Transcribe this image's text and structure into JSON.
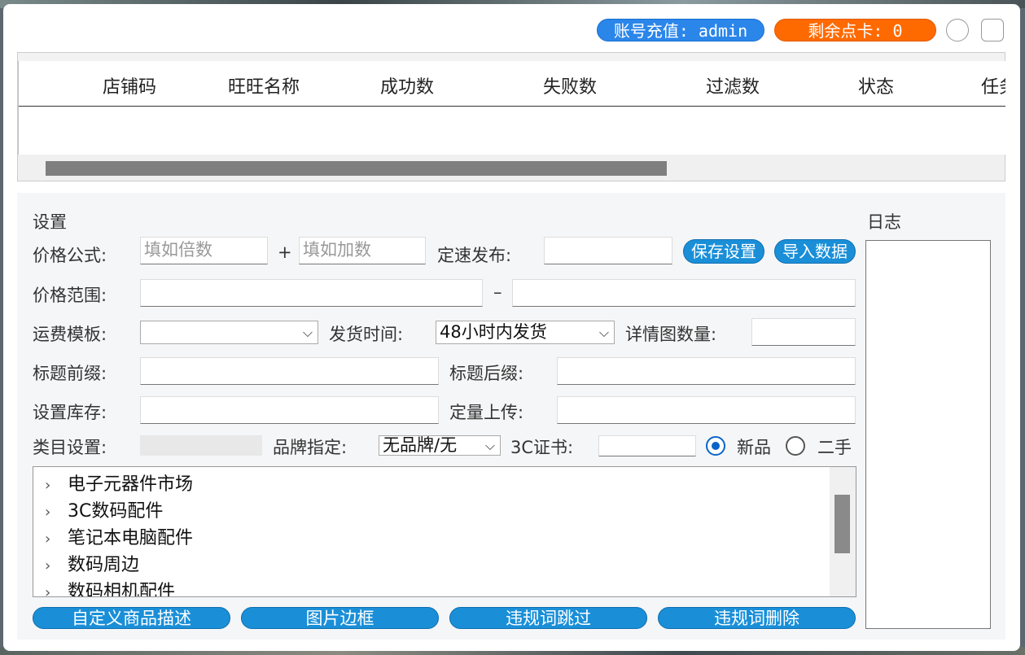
{
  "header": {
    "account_recharge": "账号充值: admin",
    "remaining_points": "剩余点卡: 0"
  },
  "table": {
    "columns": [
      "店铺码",
      "旺旺名称",
      "成功数",
      "失败数",
      "过滤数",
      "状态",
      "任务"
    ]
  },
  "settings": {
    "title": "设置",
    "price_formula_label": "价格公式:",
    "multiplier_placeholder": "填如倍数",
    "plus_sign": "+",
    "addend_placeholder": "填如加数",
    "timed_publish_label": "定速发布:",
    "save_button": "保存设置",
    "import_button": "导入数据",
    "price_range_label": "价格范围:",
    "range_dash": "–",
    "shipping_template_label": "运费模板:",
    "shipping_template_value": "",
    "ship_time_label": "发货时间:",
    "ship_time_value": "48小时内发货",
    "detail_image_count_label": "详情图数量:",
    "title_prefix_label": "标题前缀:",
    "title_suffix_label": "标题后缀:",
    "stock_label": "设置库存:",
    "fixed_upload_label": "定量上传:",
    "category_label": "类目设置:",
    "brand_label": "品牌指定:",
    "brand_value": "无品牌/无",
    "cert_3c_label": "3C证书:",
    "condition_new": "新品",
    "condition_used": "二手",
    "condition_selected": "新品"
  },
  "category_tree": [
    "电子元器件市场",
    "3C数码配件",
    "笔记本电脑配件",
    "数码周边",
    "数码相机配件"
  ],
  "bottom_buttons": {
    "custom_desc": "自定义商品描述",
    "image_border": "图片边框",
    "skip_banned": "违规词跳过",
    "delete_banned": "违规词删除"
  },
  "log": {
    "title": "日志"
  }
}
